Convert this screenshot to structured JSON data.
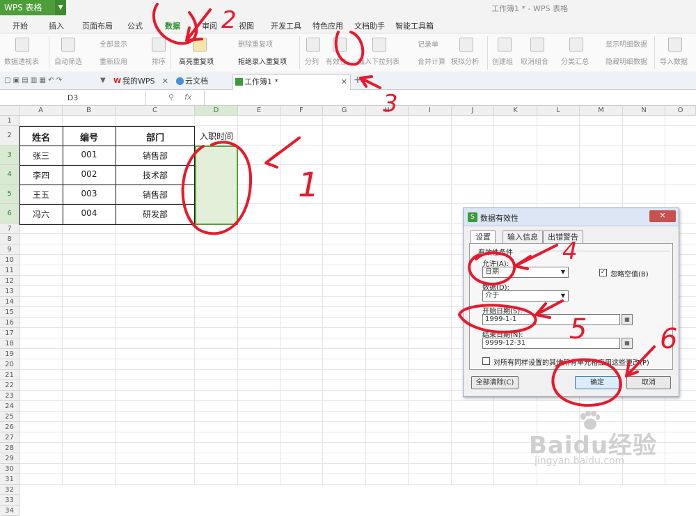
{
  "app": {
    "name": "WPS 表格",
    "window_title": "工作簿1 * - WPS 表格"
  },
  "menu": [
    "开始",
    "插入",
    "页面布局",
    "公式",
    "数据",
    "审阅",
    "视图",
    "开发工具",
    "特色应用",
    "文档助手",
    "智能工具箱"
  ],
  "ribbon": {
    "pivot": "数据透视表",
    "autofilter": "自动筛选",
    "show_all": "全部显示",
    "reapply": "重新应用",
    "sort": "排序",
    "highlight_dup": "高亮重复项",
    "del_dup": "删除重复项",
    "reject_dup": "拒绝录入重复项",
    "split": "分列",
    "validity": "有效性",
    "dropdown": "插入下拉列表",
    "record": "记录单",
    "merge": "合并计算",
    "simulate": "模拟分析",
    "group": "创建组",
    "ungroup": "取消组合",
    "subtotal": "分类汇总",
    "show_detail": "显示明细数据",
    "hide_detail": "隐藏明细数据",
    "import": "导入数据"
  },
  "tabs": {
    "mywps": "我的WPS",
    "cloud": "云文档",
    "book": "工作簿1 *"
  },
  "namebox": "D3",
  "fx": "fx",
  "columns": [
    "A",
    "B",
    "C",
    "D",
    "E",
    "F",
    "G",
    "H",
    "I",
    "J",
    "K",
    "L",
    "M",
    "N",
    "O"
  ],
  "rows": [
    "1",
    "2",
    "3",
    "4",
    "5",
    "6",
    "7",
    "8",
    "9",
    "10",
    "11",
    "12",
    "13",
    "14",
    "15",
    "16",
    "17",
    "18",
    "19",
    "20",
    "21",
    "22",
    "23",
    "24",
    "25",
    "26",
    "27",
    "28",
    "29",
    "30",
    "31",
    "32",
    "33",
    "34"
  ],
  "table": {
    "headers": [
      "姓名",
      "编号",
      "部门",
      "入职时间"
    ],
    "data": [
      [
        "张三",
        "001",
        "销售部",
        ""
      ],
      [
        "李四",
        "002",
        "技术部",
        ""
      ],
      [
        "王五",
        "003",
        "销售部",
        ""
      ],
      [
        "冯六",
        "004",
        "研发部",
        ""
      ]
    ]
  },
  "dialog": {
    "title": "数据有效性",
    "close": "✕",
    "tabs": [
      "设置",
      "输入信息",
      "出错警告"
    ],
    "section": "有效性条件",
    "allow_label": "允许(A):",
    "allow_value": "日期",
    "ignore_blank": "忽略空值(B)",
    "data_label": "数据(D):",
    "data_value": "介于",
    "start_label": "开始日期(S):",
    "start_value": "1999-1-1",
    "end_label": "结束日期(N):",
    "end_value": "9999-12-31",
    "apply_all": "对所有同样设置的其他所有单元格应用这些更改(P)",
    "clear_all": "全部清除(C)",
    "ok": "确定",
    "cancel": "取消"
  },
  "annotations": [
    "1",
    "2",
    "3",
    "4",
    "5",
    "6"
  ],
  "watermark": {
    "brand": "Baidu经验",
    "url": "jingyan.baidu.com"
  },
  "colors": {
    "accent": "#4d9e3a",
    "annotation": "#e8192c",
    "selection": "#e2f0d9"
  }
}
